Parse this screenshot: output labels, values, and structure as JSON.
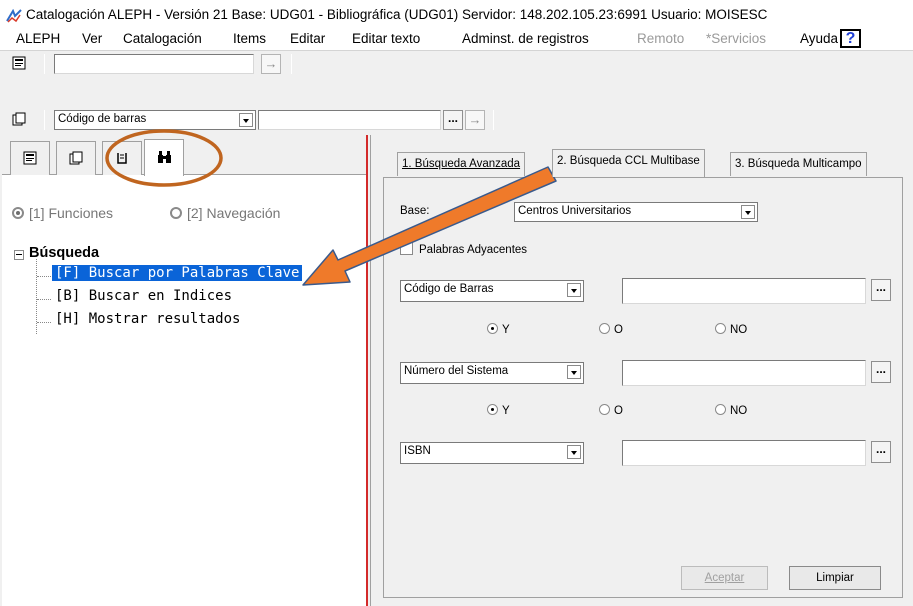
{
  "window": {
    "title": "Catalogación ALEPH - Versión 21  Base:  UDG01 - Bibliográfica (UDG01)  Servidor: 148.202.105.23:6991   Usuario:  MOISESC",
    "icon": "marc-app-icon"
  },
  "menubar": {
    "items": [
      {
        "label": "ALEPH",
        "enabled": true
      },
      {
        "label": "Ver",
        "enabled": true
      },
      {
        "label": "Catalogación",
        "enabled": true
      },
      {
        "label": "Items",
        "enabled": true
      },
      {
        "label": "Editar",
        "enabled": true
      },
      {
        "label": "Editar texto",
        "enabled": true
      },
      {
        "label": "Adminst. de registros",
        "enabled": true
      },
      {
        "label": "Remoto",
        "enabled": false
      },
      {
        "label": "*Servicios",
        "enabled": false
      },
      {
        "label": "Ayuda",
        "enabled": true
      }
    ],
    "help_icon": "?"
  },
  "toolbar1": {
    "icon": "record-icon",
    "input_value": "",
    "go_icon": "→"
  },
  "toolbar2": {
    "icon": "copy-icon",
    "combo_value": "Código de barras",
    "input_value": "",
    "ellipsis": "...",
    "go_icon": "→"
  },
  "left_panel": {
    "tabs": [
      {
        "icon": "record-icon"
      },
      {
        "icon": "copy-icon"
      },
      {
        "icon": "order-icon"
      },
      {
        "icon": "binoculars-icon",
        "active": true
      }
    ],
    "radio_functions": "[1] Funciones",
    "radio_navigation": "[2] Navegación",
    "tree": {
      "group": "Búsqueda",
      "items": [
        {
          "label": "[F] Buscar por Palabras Clave",
          "selected": true
        },
        {
          "label": "[B] Buscar en Indices",
          "selected": false
        },
        {
          "label": "[H] Mostrar resultados",
          "selected": false
        }
      ]
    }
  },
  "right_panel": {
    "tabs": [
      {
        "label": "1. Búsqueda Avanzada",
        "active": false
      },
      {
        "label": "2. Búsqueda CCL Multibase",
        "active": true
      },
      {
        "label": "3. Búsqueda Multicampo",
        "active": false
      }
    ],
    "base_label": "Base:",
    "base_value": "Centros Universitarios",
    "adjacent_words": "Palabras Adyacentes",
    "rows": [
      {
        "field": "Código de Barras",
        "value": ""
      },
      {
        "field": "Número del Sistema",
        "value": ""
      },
      {
        "field": "ISBN",
        "value": ""
      }
    ],
    "operators": {
      "and": "Y",
      "or": "O",
      "not": "NO"
    },
    "ellipsis": "...",
    "accept_button": "Aceptar",
    "clear_button": "Limpiar"
  },
  "annotations": {
    "circle_color": "#c0651f",
    "arrow_color": "#ef7a2a",
    "arrow_outline": "#3a5a8c"
  }
}
